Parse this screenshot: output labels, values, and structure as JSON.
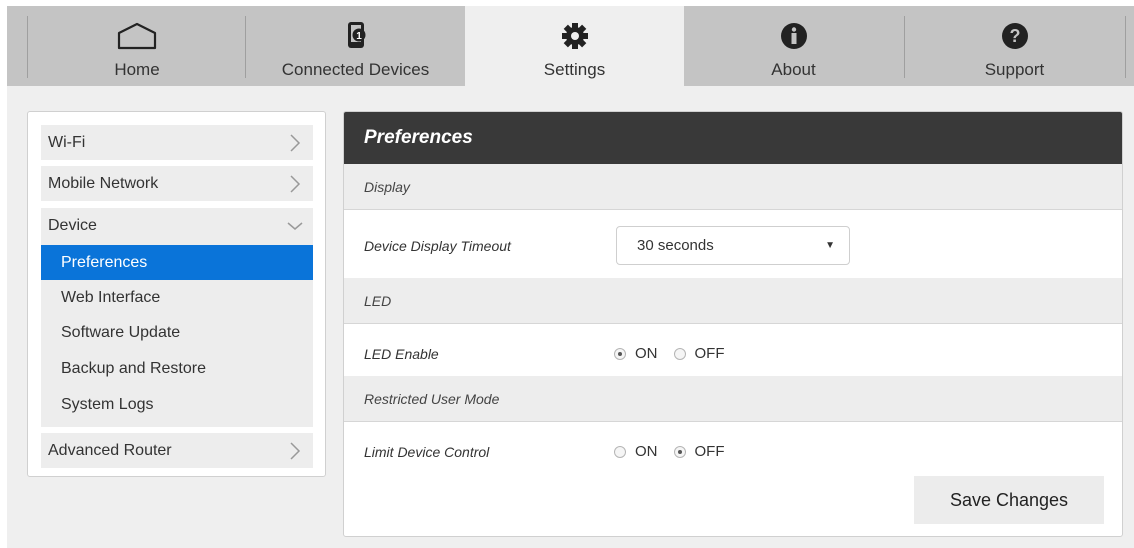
{
  "nav": {
    "tabs": [
      {
        "label": "Home",
        "icon": "home-icon"
      },
      {
        "label": "Connected Devices",
        "icon": "connected-devices-icon",
        "badge": "1"
      },
      {
        "label": "Settings",
        "icon": "gear-icon",
        "active": true
      },
      {
        "label": "About",
        "icon": "info-icon"
      },
      {
        "label": "Support",
        "icon": "question-icon"
      }
    ]
  },
  "sidebar": {
    "items": [
      {
        "label": "Wi-Fi"
      },
      {
        "label": "Mobile Network"
      },
      {
        "label": "Device",
        "expanded": true,
        "children": [
          "Preferences",
          "Web Interface",
          "Software Update",
          "Backup and Restore",
          "System Logs"
        ],
        "selected": "Preferences"
      },
      {
        "label": "Advanced Router"
      }
    ]
  },
  "panel": {
    "title": "Preferences",
    "sections": {
      "display": {
        "header": "Display",
        "timeout_label": "Device Display Timeout",
        "timeout_value": "30 seconds"
      },
      "led": {
        "header": "LED",
        "enable_label": "LED Enable",
        "on_label": "ON",
        "off_label": "OFF",
        "selected": "ON"
      },
      "restricted": {
        "header": "Restricted User Mode",
        "limit_label": "Limit Device Control",
        "on_label": "ON",
        "off_label": "OFF",
        "selected": "OFF"
      }
    },
    "save_label": "Save Changes"
  },
  "colors": {
    "nav_bg": "#c4c4c4",
    "page_bg": "#efefef",
    "header_bg": "#393939",
    "selected_bg": "#0a74d9"
  }
}
